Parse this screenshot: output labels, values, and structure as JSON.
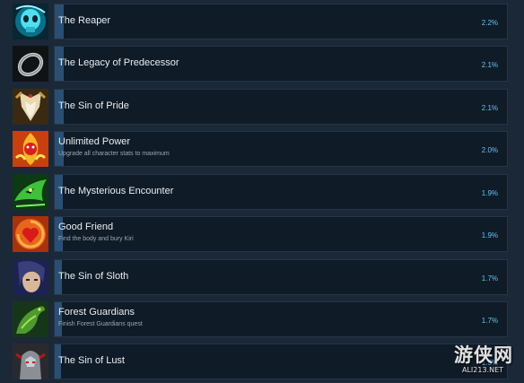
{
  "achievements": [
    {
      "title": "The Reaper",
      "description": "",
      "percent_label": "2.2%",
      "percent": 2.2,
      "icon": "reaper-skull-icon"
    },
    {
      "title": "The Legacy of Predecessor",
      "description": "",
      "percent_label": "2.1%",
      "percent": 2.1,
      "icon": "silver-ring-icon"
    },
    {
      "title": "The Sin of Pride",
      "description": "",
      "percent_label": "2.1%",
      "percent": 2.1,
      "icon": "pride-mask-icon"
    },
    {
      "title": "Unlimited Power",
      "description": "Upgrade all character stats to maximum",
      "percent_label": "2.0%",
      "percent": 2.0,
      "icon": "fire-demon-icon"
    },
    {
      "title": "The Mysterious Encounter",
      "description": "",
      "percent_label": "1.9%",
      "percent": 1.9,
      "icon": "green-creature-icon"
    },
    {
      "title": "Good Friend",
      "description": "Find the body and bury Kiri",
      "percent_label": "1.9%",
      "percent": 1.9,
      "icon": "heart-swirl-icon"
    },
    {
      "title": "The Sin of Sloth",
      "description": "",
      "percent_label": "1.7%",
      "percent": 1.7,
      "icon": "sloth-portrait-icon"
    },
    {
      "title": "Forest Guardians",
      "description": "Finish Forest Guardians quest",
      "percent_label": "1.7%",
      "percent": 1.7,
      "icon": "forest-lizard-icon"
    },
    {
      "title": "The Sin of Lust",
      "description": "",
      "percent_label": "1.5%",
      "percent": 1.5,
      "icon": "lust-knight-icon"
    }
  ],
  "watermark": {
    "text": "游侠网",
    "sub": "ALI213.NET"
  }
}
